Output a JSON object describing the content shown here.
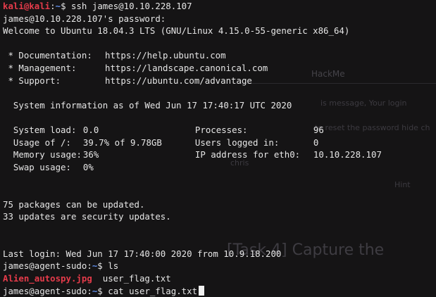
{
  "background_page": {
    "texts": [
      "HackMe",
      "is message, Your login",
      "to reset the password hide ch",
      "chris",
      "Hint",
      "[Task 4] Capture the"
    ]
  },
  "terminal": {
    "prompt_kali_user": "kali@kali",
    "prompt_kali_path": "~",
    "prompt_kali_sign": "$",
    "cmd_ssh": "ssh james@10.10.228.107",
    "password_prompt": "james@10.10.228.107's password:",
    "welcome": "Welcome to Ubuntu 18.04.3 LTS (GNU/Linux 4.15.0-55-generic x86_64)",
    "links": [
      {
        "label": " * Documentation:",
        "url": "https://help.ubuntu.com"
      },
      {
        "label": " * Management:",
        "url": "https://landscape.canonical.com"
      },
      {
        "label": " * Support:",
        "url": "https://ubuntu.com/advantage"
      }
    ],
    "sysinfo_header": "System information as of Wed Jun 17 17:40:17 UTC 2020",
    "stats_left": [
      {
        "label": "System load:",
        "value": "0.0"
      },
      {
        "label": "Usage of /:",
        "value": "39.7% of 9.78GB"
      },
      {
        "label": "Memory usage:",
        "value": "36%"
      },
      {
        "label": "Swap usage:",
        "value": "0%"
      }
    ],
    "stats_right": [
      {
        "label": "Processes:",
        "value": "96"
      },
      {
        "label": "Users logged in:",
        "value": "0"
      },
      {
        "label": "IP address for eth0:",
        "value": "10.10.228.107"
      }
    ],
    "updates_1": "75 packages can be updated.",
    "updates_2": "33 updates are security updates.",
    "last_login": "Last login: Wed Jun 17 17:40:00 2020 from 10.9.18.200",
    "prompt_remote_user": "james@agent-sudo",
    "prompt_remote_path": "~",
    "prompt_remote_sign": "$",
    "cmd_ls": "ls",
    "files": [
      "Alien_autospy.jpg",
      "user_flag.txt"
    ],
    "cmd_cat": "cat user_flag.txt"
  },
  "colors": {
    "background": "#151415",
    "prompt_red": "#e53b4a",
    "path_blue": "#5f8de8",
    "text": "#e6e6e6"
  }
}
